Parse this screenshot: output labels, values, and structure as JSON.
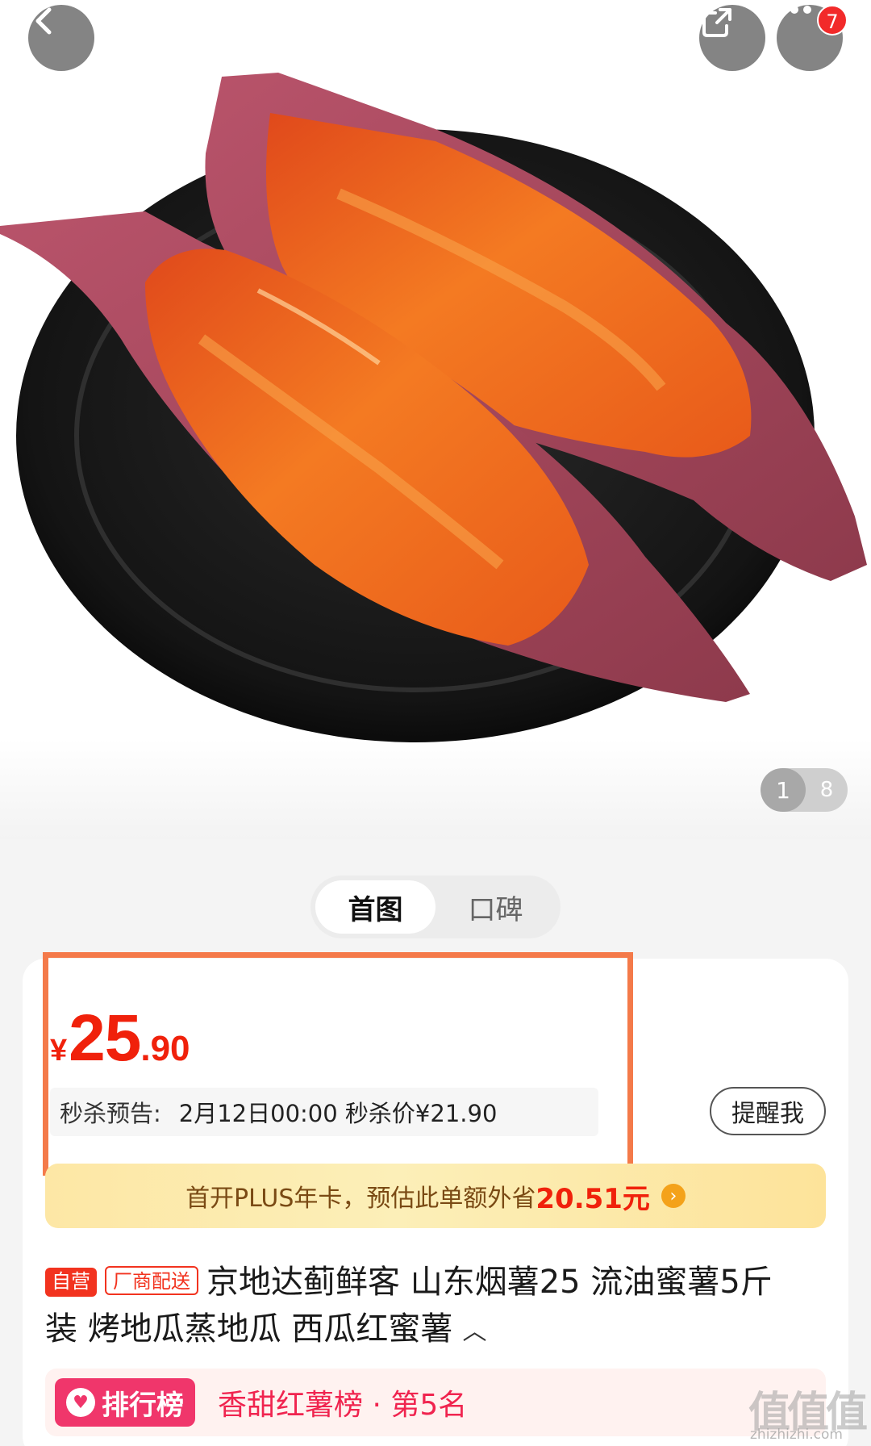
{
  "header": {
    "back_icon": "chevron-left-icon",
    "share_icon": "share-icon",
    "more_icon": "more-dots-icon",
    "notification_count": "7"
  },
  "gallery": {
    "image_subject": "roasted sweet potatoes on black plate",
    "current_page": "1",
    "total_pages": "8"
  },
  "tabs": [
    {
      "label": "首图",
      "active": true
    },
    {
      "label": "口碑",
      "active": false
    }
  ],
  "price": {
    "currency": "¥",
    "integer": "25",
    "decimal": ".90",
    "color": "#f0210b"
  },
  "flash_sale": {
    "label": "秒杀预告:",
    "info": "2月12日00:00 秒杀价¥21.90",
    "remind_label": "提醒我"
  },
  "plus_offer": {
    "text": "首开PLUS年卡，预估此单额外省",
    "amount": "20.51元"
  },
  "product": {
    "tag_self": "自营",
    "tag_vendor": "厂商配送",
    "title": "京地达蓟鲜客 山东烟薯25 流油蜜薯5斤装  烤地瓜蒸地瓜  西瓜红蜜薯"
  },
  "ranking": {
    "badge_label": "排行榜",
    "text": "香甜红薯榜 · 第5名"
  },
  "watermark": {
    "mark": "值值值",
    "url": "zhizhizhi.com"
  }
}
